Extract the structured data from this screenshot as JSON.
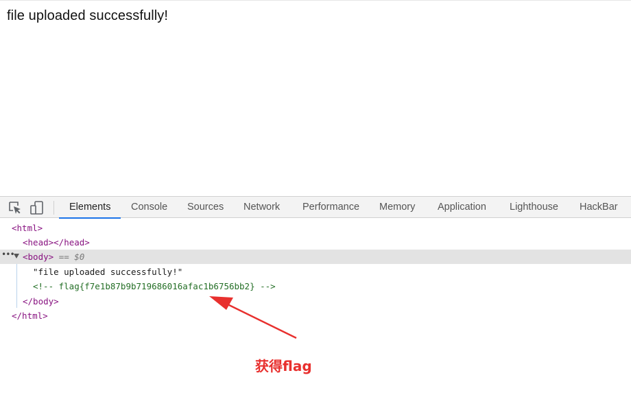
{
  "page": {
    "content_text": "file uploaded successfully!"
  },
  "devtools": {
    "toolbar_icons": [
      "inspect-element-icon",
      "device-toolbar-icon"
    ],
    "tabs": [
      {
        "label": "Elements",
        "active": true
      },
      {
        "label": "Console"
      },
      {
        "label": "Sources"
      },
      {
        "label": "Network"
      },
      {
        "label": "Performance"
      },
      {
        "label": "Memory"
      },
      {
        "label": "Application"
      },
      {
        "label": "Lighthouse"
      },
      {
        "label": "HackBar"
      }
    ],
    "accent_color": "#1a73e8",
    "dom": {
      "html_open": "<html>",
      "head_line": "<head></head>",
      "body_open": "<body>",
      "body_ref": "== $0",
      "text_node": "\"file uploaded successfully!\"",
      "comment_node": "<!-- flag{f7e1b87b9b719686016afac1b6756bb2} -->",
      "body_close": "</body>",
      "html_close": "</html>"
    }
  },
  "annotation": {
    "text": "获得flag",
    "color": "#e8302e"
  }
}
